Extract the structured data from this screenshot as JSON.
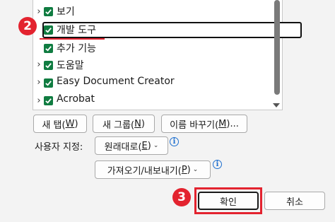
{
  "tree": {
    "items": [
      {
        "label": "보기",
        "checked": true,
        "expandable": true
      },
      {
        "label": "개발 도구",
        "checked": true,
        "expandable": false,
        "highlighted": true
      },
      {
        "label": "추가 기능",
        "checked": true,
        "expandable": false
      },
      {
        "label": "도움말",
        "checked": true,
        "expandable": true
      },
      {
        "label": "Easy Document Creator",
        "checked": true,
        "expandable": true
      },
      {
        "label": "Acrobat",
        "checked": true,
        "expandable": true
      }
    ]
  },
  "badges": {
    "step2": "2",
    "step3": "3"
  },
  "buttons": {
    "new_tab": {
      "text": "새 탭(",
      "key": "W",
      "close": ")"
    },
    "new_group": {
      "text": "새 그룹(",
      "key": "N",
      "close": ")"
    },
    "rename": {
      "text": "이름 바꾸기(",
      "key": "M",
      "close": ")..."
    }
  },
  "customize": {
    "label": "사용자 지정:",
    "reset": {
      "text": "원래대로(",
      "key": "E",
      "close": ")"
    },
    "import_export": {
      "text": "가져오기/내보내기(",
      "key": "P",
      "close": ")"
    }
  },
  "dialog": {
    "ok": "확인",
    "cancel": "취소"
  },
  "icons": {
    "info": "info-icon",
    "check": "check-icon",
    "expander": "chevron-right-icon",
    "dropdown": "chevron-down-icon"
  },
  "colors": {
    "checkbox": "#107c41",
    "accent_red": "#e3232f",
    "info_blue": "#1e6fcf"
  }
}
